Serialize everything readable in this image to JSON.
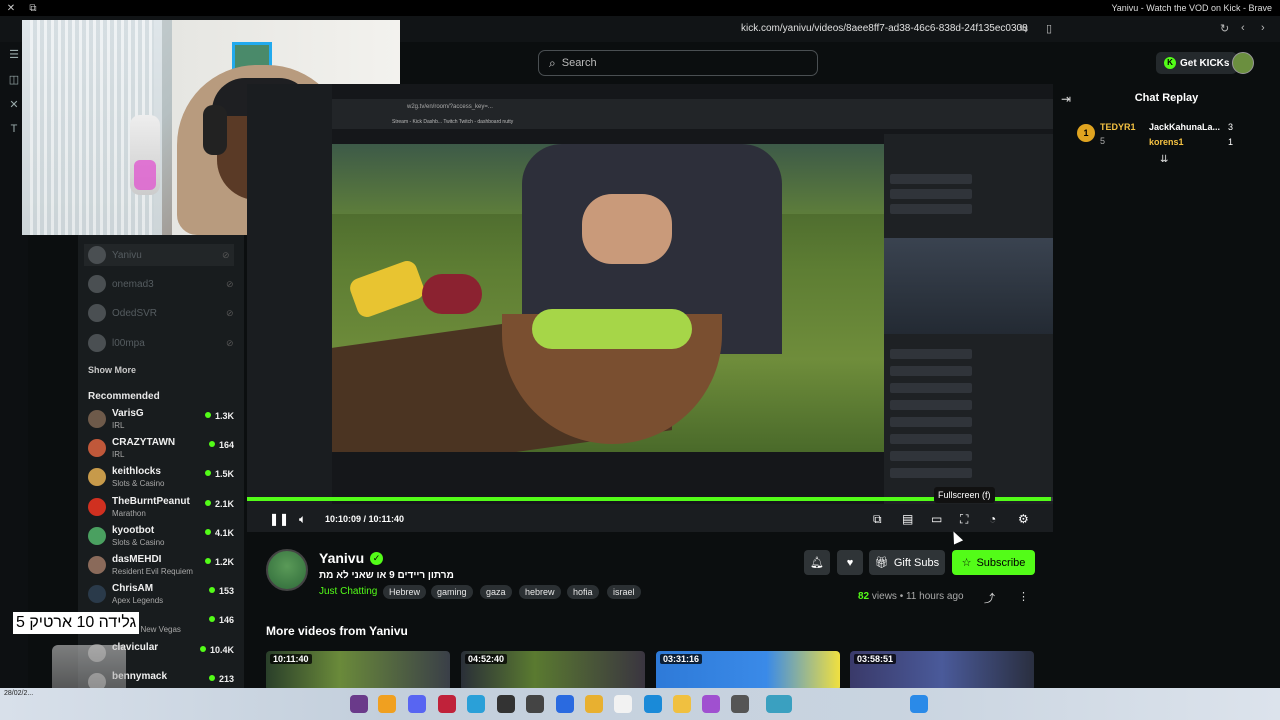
{
  "window": {
    "title": "Yanivu - Watch the VOD on Kick - Brave",
    "url": "kick.com/yanivu/videos/8aee8ff7-ad38-46c6-838d-24f135ec0308"
  },
  "header": {
    "search_placeholder": "Search",
    "get_kicks_label": "Get KICKs"
  },
  "sidebar": {
    "followed": [
      {
        "name": "Yanivu"
      },
      {
        "name": "onemad3"
      },
      {
        "name": "OdedSVR"
      },
      {
        "name": "l00mpa"
      }
    ],
    "show_more": "Show More",
    "recommended_heading": "Recommended",
    "recommended": [
      {
        "name": "VarisG",
        "category": "IRL",
        "viewers": "1.3K",
        "color": "#6e5a4a"
      },
      {
        "name": "CRAZYTAWN",
        "category": "IRL",
        "viewers": "164",
        "color": "#c0583a"
      },
      {
        "name": "keithlocks",
        "category": "Slots & Casino",
        "viewers": "1.5K",
        "color": "#c79a4a"
      },
      {
        "name": "TheBurntPeanut",
        "category": "Marathon",
        "viewers": "2.1K",
        "color": "#d03020"
      },
      {
        "name": "kyootbot",
        "category": "Slots & Casino",
        "viewers": "4.1K",
        "color": "#4aa060"
      },
      {
        "name": "dasMEHDI",
        "category": "Resident Evil Requiem",
        "viewers": "1.2K",
        "color": "#8a6a5a"
      },
      {
        "name": "ChrisAM",
        "category": "Apex Legends",
        "viewers": "153",
        "color": "#2a3a4a"
      },
      {
        "name": "",
        "category": "Fallout: New Vegas",
        "viewers": "146",
        "color": "#666"
      },
      {
        "name": "clavicular",
        "category": "",
        "viewers": "10.4K",
        "color": "#777"
      },
      {
        "name": "bennymack",
        "category": "",
        "viewers": "213",
        "color": "#888"
      }
    ]
  },
  "player": {
    "time_display": "10:10:09 / 10:11:40",
    "progress_fraction": 0.998,
    "tooltip": "Fullscreen (f)"
  },
  "chat": {
    "title": "Chat Replay",
    "leaderboard": {
      "rank": "1",
      "top_user": "TEDYR1",
      "top_count": "5",
      "user2": "JackKahunaLa...",
      "user2_count": "3",
      "user3": "korens1",
      "user3_count": "1"
    }
  },
  "channel": {
    "name": "Yanivu",
    "stream_title": "מרתון ריידים 9 או שאני לא מת",
    "category": "Just Chatting",
    "tags": [
      "Hebrew",
      "gaming",
      "gaza",
      "hebrew",
      "hofia",
      "israel"
    ],
    "gift_subs_label": "Gift Subs",
    "subscribe_label": "Subscribe",
    "views": "82",
    "views_label": "views",
    "age": "11 hours ago",
    "more_videos_heading": "More videos from Yanivu",
    "videos": [
      {
        "duration": "10:11:40"
      },
      {
        "duration": "04:52:40"
      },
      {
        "duration": "03:31:16"
      },
      {
        "duration": "03:58:51"
      }
    ]
  },
  "overlay": {
    "hebrew_text": "גלידה 10 ארטיק 5"
  },
  "taskbar": {
    "date": "28/02/2..."
  },
  "colors": {
    "accent": "#53fc18",
    "background": "#0b0e0f"
  }
}
